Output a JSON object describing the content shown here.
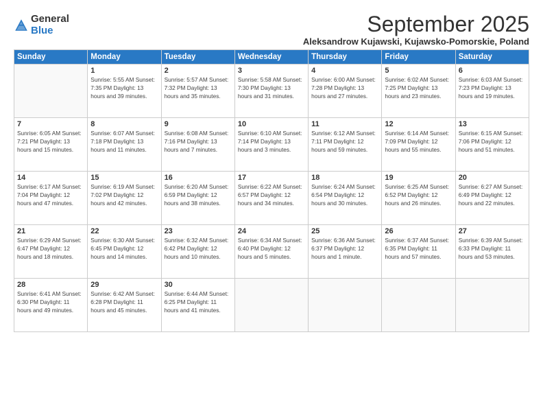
{
  "logo": {
    "general": "General",
    "blue": "Blue"
  },
  "title": "September 2025",
  "location": "Aleksandrow Kujawski, Kujawsko-Pomorskie, Poland",
  "headers": [
    "Sunday",
    "Monday",
    "Tuesday",
    "Wednesday",
    "Thursday",
    "Friday",
    "Saturday"
  ],
  "weeks": [
    [
      {
        "day": "",
        "info": ""
      },
      {
        "day": "1",
        "info": "Sunrise: 5:55 AM\nSunset: 7:35 PM\nDaylight: 13 hours\nand 39 minutes."
      },
      {
        "day": "2",
        "info": "Sunrise: 5:57 AM\nSunset: 7:32 PM\nDaylight: 13 hours\nand 35 minutes."
      },
      {
        "day": "3",
        "info": "Sunrise: 5:58 AM\nSunset: 7:30 PM\nDaylight: 13 hours\nand 31 minutes."
      },
      {
        "day": "4",
        "info": "Sunrise: 6:00 AM\nSunset: 7:28 PM\nDaylight: 13 hours\nand 27 minutes."
      },
      {
        "day": "5",
        "info": "Sunrise: 6:02 AM\nSunset: 7:25 PM\nDaylight: 13 hours\nand 23 minutes."
      },
      {
        "day": "6",
        "info": "Sunrise: 6:03 AM\nSunset: 7:23 PM\nDaylight: 13 hours\nand 19 minutes."
      }
    ],
    [
      {
        "day": "7",
        "info": "Sunrise: 6:05 AM\nSunset: 7:21 PM\nDaylight: 13 hours\nand 15 minutes."
      },
      {
        "day": "8",
        "info": "Sunrise: 6:07 AM\nSunset: 7:18 PM\nDaylight: 13 hours\nand 11 minutes."
      },
      {
        "day": "9",
        "info": "Sunrise: 6:08 AM\nSunset: 7:16 PM\nDaylight: 13 hours\nand 7 minutes."
      },
      {
        "day": "10",
        "info": "Sunrise: 6:10 AM\nSunset: 7:14 PM\nDaylight: 13 hours\nand 3 minutes."
      },
      {
        "day": "11",
        "info": "Sunrise: 6:12 AM\nSunset: 7:11 PM\nDaylight: 12 hours\nand 59 minutes."
      },
      {
        "day": "12",
        "info": "Sunrise: 6:14 AM\nSunset: 7:09 PM\nDaylight: 12 hours\nand 55 minutes."
      },
      {
        "day": "13",
        "info": "Sunrise: 6:15 AM\nSunset: 7:06 PM\nDaylight: 12 hours\nand 51 minutes."
      }
    ],
    [
      {
        "day": "14",
        "info": "Sunrise: 6:17 AM\nSunset: 7:04 PM\nDaylight: 12 hours\nand 47 minutes."
      },
      {
        "day": "15",
        "info": "Sunrise: 6:19 AM\nSunset: 7:02 PM\nDaylight: 12 hours\nand 42 minutes."
      },
      {
        "day": "16",
        "info": "Sunrise: 6:20 AM\nSunset: 6:59 PM\nDaylight: 12 hours\nand 38 minutes."
      },
      {
        "day": "17",
        "info": "Sunrise: 6:22 AM\nSunset: 6:57 PM\nDaylight: 12 hours\nand 34 minutes."
      },
      {
        "day": "18",
        "info": "Sunrise: 6:24 AM\nSunset: 6:54 PM\nDaylight: 12 hours\nand 30 minutes."
      },
      {
        "day": "19",
        "info": "Sunrise: 6:25 AM\nSunset: 6:52 PM\nDaylight: 12 hours\nand 26 minutes."
      },
      {
        "day": "20",
        "info": "Sunrise: 6:27 AM\nSunset: 6:49 PM\nDaylight: 12 hours\nand 22 minutes."
      }
    ],
    [
      {
        "day": "21",
        "info": "Sunrise: 6:29 AM\nSunset: 6:47 PM\nDaylight: 12 hours\nand 18 minutes."
      },
      {
        "day": "22",
        "info": "Sunrise: 6:30 AM\nSunset: 6:45 PM\nDaylight: 12 hours\nand 14 minutes."
      },
      {
        "day": "23",
        "info": "Sunrise: 6:32 AM\nSunset: 6:42 PM\nDaylight: 12 hours\nand 10 minutes."
      },
      {
        "day": "24",
        "info": "Sunrise: 6:34 AM\nSunset: 6:40 PM\nDaylight: 12 hours\nand 5 minutes."
      },
      {
        "day": "25",
        "info": "Sunrise: 6:36 AM\nSunset: 6:37 PM\nDaylight: 12 hours\nand 1 minute."
      },
      {
        "day": "26",
        "info": "Sunrise: 6:37 AM\nSunset: 6:35 PM\nDaylight: 11 hours\nand 57 minutes."
      },
      {
        "day": "27",
        "info": "Sunrise: 6:39 AM\nSunset: 6:33 PM\nDaylight: 11 hours\nand 53 minutes."
      }
    ],
    [
      {
        "day": "28",
        "info": "Sunrise: 6:41 AM\nSunset: 6:30 PM\nDaylight: 11 hours\nand 49 minutes."
      },
      {
        "day": "29",
        "info": "Sunrise: 6:42 AM\nSunset: 6:28 PM\nDaylight: 11 hours\nand 45 minutes."
      },
      {
        "day": "30",
        "info": "Sunrise: 6:44 AM\nSunset: 6:25 PM\nDaylight: 11 hours\nand 41 minutes."
      },
      {
        "day": "",
        "info": ""
      },
      {
        "day": "",
        "info": ""
      },
      {
        "day": "",
        "info": ""
      },
      {
        "day": "",
        "info": ""
      }
    ]
  ]
}
